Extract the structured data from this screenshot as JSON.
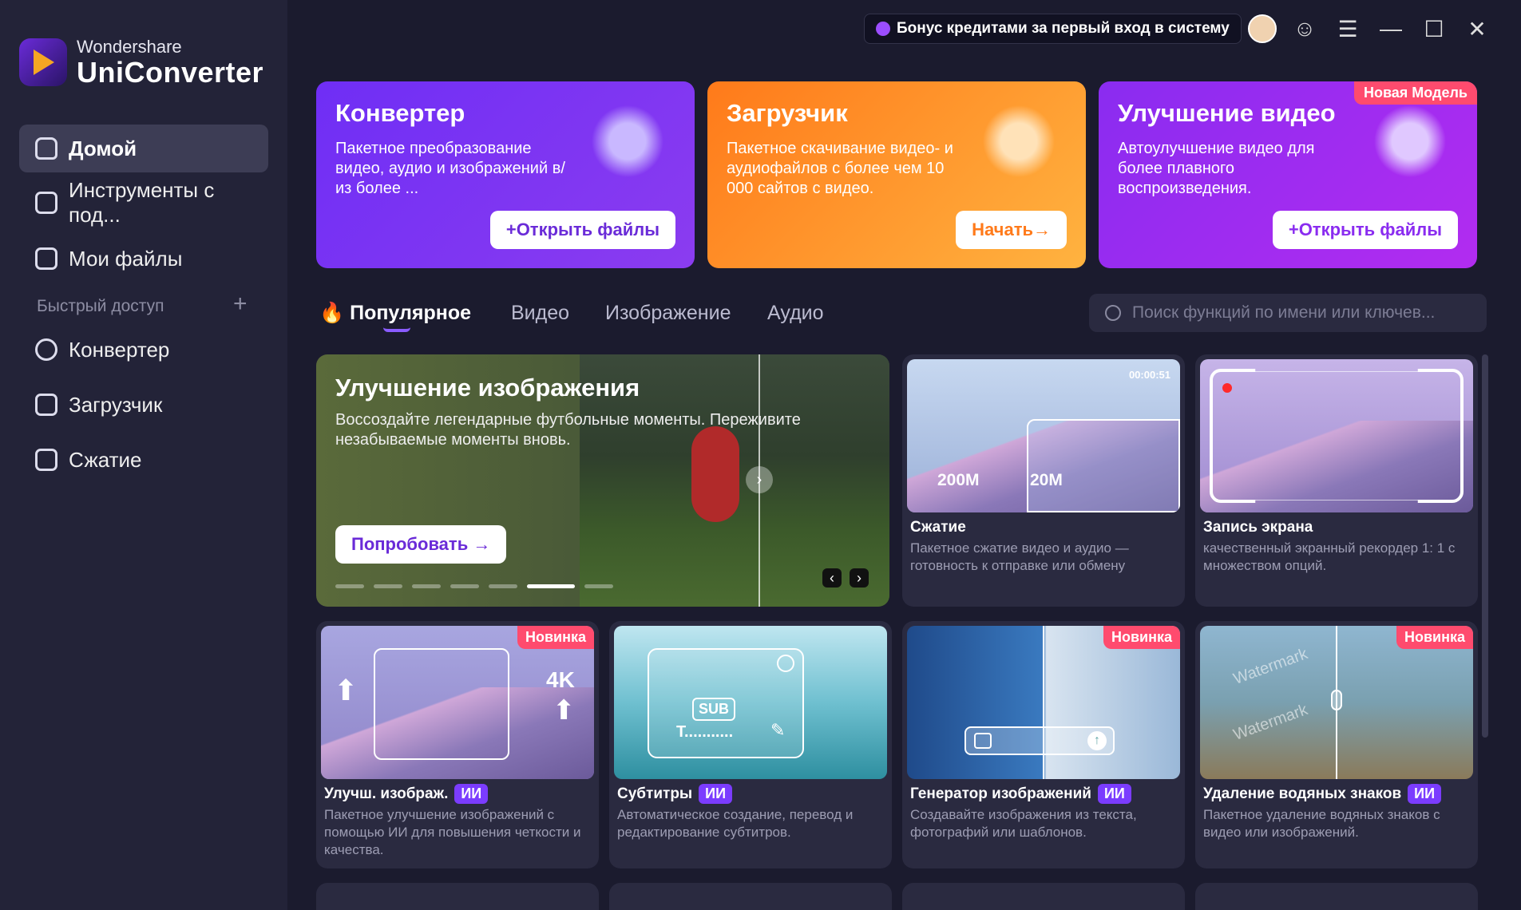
{
  "app": {
    "brand_top": "Wondershare",
    "brand_main": "UniConverter"
  },
  "sidebar": {
    "items": [
      {
        "label": "Домой"
      },
      {
        "label": "Инструменты с под..."
      },
      {
        "label": "Мои файлы"
      }
    ],
    "quick_title": "Быстрый доступ",
    "quick_items": [
      {
        "label": "Конвертер"
      },
      {
        "label": "Загрузчик"
      },
      {
        "label": "Сжатие"
      }
    ]
  },
  "topbar": {
    "bonus": "Бонус кредитами за первый вход в систему"
  },
  "features": [
    {
      "title": "Конвертер",
      "desc": "Пакетное преобразование видео, аудио и изображений в/из более ...",
      "button": "+Открыть файлы",
      "color": "#6c2bf0"
    },
    {
      "title": "Загрузчик",
      "desc": "Пакетное скачивание видео- и аудиофайлов с более чем 10 000 сайтов с видео.",
      "button": "Начать→",
      "color": "#ff8a1e"
    },
    {
      "title": "Улучшение видео",
      "desc": "Автоулучшение видео для более плавного воспроизведения.",
      "button": "+Открыть файлы",
      "badge": "Новая Модель",
      "color": "#9b2cf2"
    }
  ],
  "tabs": [
    {
      "label": "Популярное"
    },
    {
      "label": "Видео"
    },
    {
      "label": "Изображение"
    },
    {
      "label": "Аудио"
    }
  ],
  "search": {
    "placeholder": "Поиск функций по имени или ключев..."
  },
  "hero": {
    "title": "Улучшение изображения",
    "desc": "Воссоздайте легендарные футбольные моменты. Переживите незабываемые моменты вновь.",
    "button": "Попробовать →"
  },
  "cards_top": [
    {
      "title": "Сжатие",
      "desc": "Пакетное сжатие видео и аудио — готовность к отправке или обмену",
      "time": "00:00:51",
      "size_from": "200M",
      "size_to": "20M"
    },
    {
      "title": "Запись экрана",
      "desc": "качественный экранный рекордер 1: 1 с множеством опций."
    }
  ],
  "cards_bottom": [
    {
      "title": "Улучш. изображ.",
      "ai": "ИИ",
      "desc": "Пакетное улучшение изображений с помощью ИИ для повышения четкости и качества.",
      "badge": "Новинка",
      "extra": "4K"
    },
    {
      "title": "Субтитры",
      "ai": "ИИ",
      "desc": "Автоматическое создание, перевод и редактирование субтитров.",
      "extra": "SUB",
      "extra2": "T..........."
    },
    {
      "title": "Генератор изображений",
      "ai": "ИИ",
      "desc": "Создавайте изображения из текста, фотографий или шаблонов.",
      "badge": "Новинка"
    },
    {
      "title": "Удаление водяных знаков",
      "ai": "ИИ",
      "desc": "Пакетное удаление водяных знаков с видео или изображений.",
      "badge": "Новинка",
      "extra": "Watermark"
    }
  ]
}
